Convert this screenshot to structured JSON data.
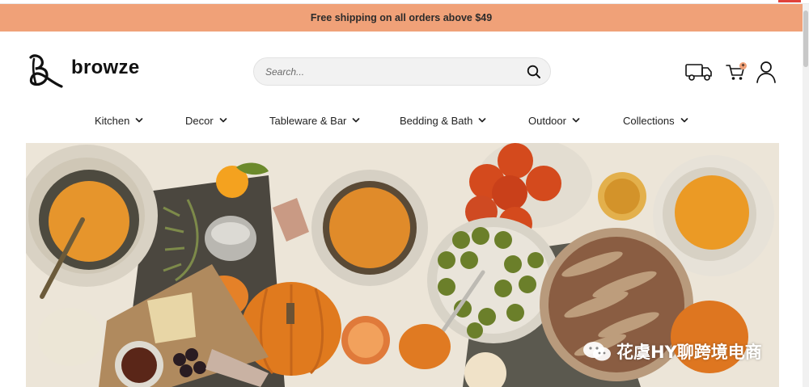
{
  "announcement": {
    "text": "Free shipping on all orders above $49"
  },
  "brand": {
    "name": "browze"
  },
  "search": {
    "placeholder": "Search..."
  },
  "header_icons": {
    "truck": "truck-icon",
    "cart": "cart-icon",
    "account": "account-icon",
    "cart_badge": "+"
  },
  "nav": {
    "items": [
      {
        "label": "Kitchen"
      },
      {
        "label": "Decor"
      },
      {
        "label": "Tableware & Bar"
      },
      {
        "label": "Bedding & Bath"
      },
      {
        "label": "Outdoor"
      },
      {
        "label": "Collections"
      }
    ]
  },
  "hero": {
    "alt": "Autumn table spread"
  },
  "watermark": {
    "text": "花虞HY聊跨境电商"
  },
  "colors": {
    "announcement_bg": "#f0a178",
    "accent": "#f0a178",
    "text": "#222222",
    "brand": "#111111"
  }
}
